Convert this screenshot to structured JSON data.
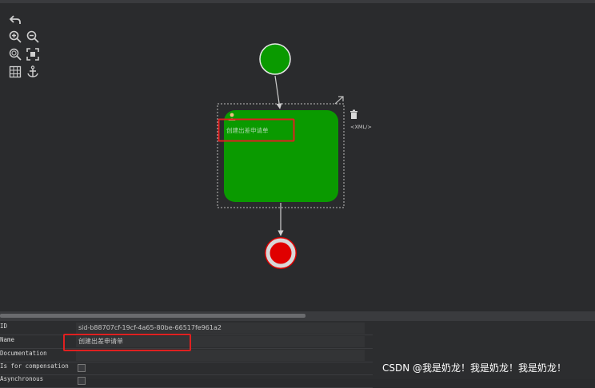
{
  "colors": {
    "canvas_bg": "#2a2b2d",
    "task_fill": "#0a9a00",
    "start_fill": "#0a9a00",
    "end_fill": "#e00000",
    "highlight": "#e02020",
    "selection": "#bdbdbd"
  },
  "toolbar": {
    "icons": [
      "undo-icon",
      "zoom-in-icon",
      "zoom-out-icon",
      "zoom-actual-icon",
      "zoom-fit-icon",
      "grid-icon",
      "anchor-icon"
    ]
  },
  "diagram": {
    "task_label": "创建出差申请单",
    "xml_label": "<XML/>"
  },
  "properties": {
    "rows": [
      {
        "label": "ID",
        "value": "sid-b88707cf-19cf-4a65-80be-66517fe961a2",
        "kind": "text"
      },
      {
        "label": "Name",
        "value": "创建出差申请单",
        "kind": "text"
      },
      {
        "label": "Documentation",
        "value": "",
        "kind": "text"
      },
      {
        "label": "Is for compensation",
        "value": "",
        "kind": "checkbox"
      },
      {
        "label": "Asynchronous",
        "value": "",
        "kind": "checkbox"
      }
    ]
  },
  "watermark": "CSDN @我是奶龙！我是奶龙！我是奶龙！"
}
